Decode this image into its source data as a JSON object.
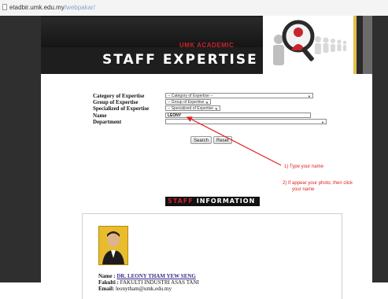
{
  "browser": {
    "url_host": "etadbir.umk.edu.my",
    "url_path": "/webpakar/"
  },
  "header": {
    "subtitle": "UMK ACADEMIC",
    "title": "STAFF EXPERTISE"
  },
  "form": {
    "category": {
      "label": "Category of Expertise",
      "value": "-- Category of Expertise --"
    },
    "group": {
      "label": "Group of Expertise",
      "value": "-- Group of Expertise --"
    },
    "specialized": {
      "label": "Specialized of Expertise",
      "value": "-- Specialized of Expertise --"
    },
    "name": {
      "label": "Name",
      "value": "LEONY"
    },
    "department": {
      "label": "Department",
      "value": ""
    },
    "search_label": "Search",
    "reset_label": "Reset"
  },
  "annotations": {
    "note1": "1) Type your name",
    "note2_line1": "2) If appear your photo, then click",
    "note2_line2": "your name"
  },
  "section": {
    "word1": "STAFF",
    "word2": "INFORMATION"
  },
  "result": {
    "name_label": "Name :",
    "name_value": "DR. LEONY THAM YEW SENG",
    "faculty_label": "Fakulti :",
    "faculty_value": "FAKULTI INDUSTRI ASAS TANI",
    "email_label": "Email:",
    "email_value": "leonytham@umk.edu.my"
  },
  "colors": {
    "accent_red": "#c8242b",
    "annotation_red": "#e02020",
    "link": "#3a2d8c",
    "page_dark": "#2f2f2f"
  },
  "icons": [
    "page-icon",
    "magnifier-people-logo",
    "dropdown-arrow-icon"
  ]
}
